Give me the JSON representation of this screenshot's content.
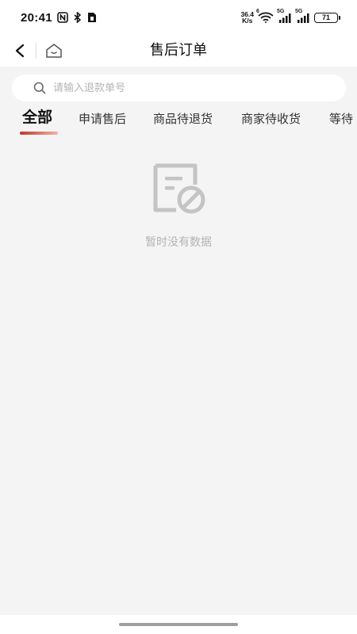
{
  "status_bar": {
    "time": "20:41",
    "net_speed_value": "36.4",
    "net_speed_unit": "K/s",
    "signal_1_label": "5G",
    "signal_2_label": "5G",
    "battery_level": "71",
    "wifi_label": "6"
  },
  "nav": {
    "title": "售后订单"
  },
  "search": {
    "placeholder": "请输入退款单号",
    "value": ""
  },
  "tabs": [
    {
      "label": "全部",
      "active": true
    },
    {
      "label": "申请售后",
      "active": false
    },
    {
      "label": "商品待退货",
      "active": false
    },
    {
      "label": "商家待收货",
      "active": false
    },
    {
      "label": "等待",
      "active": false
    }
  ],
  "empty_state": {
    "message": "暂时没有数据",
    "icon": "no-data-document-icon"
  },
  "colors": {
    "accent": "#c0392b",
    "background": "#f4f4f4",
    "muted_text": "#b3b3b3"
  }
}
